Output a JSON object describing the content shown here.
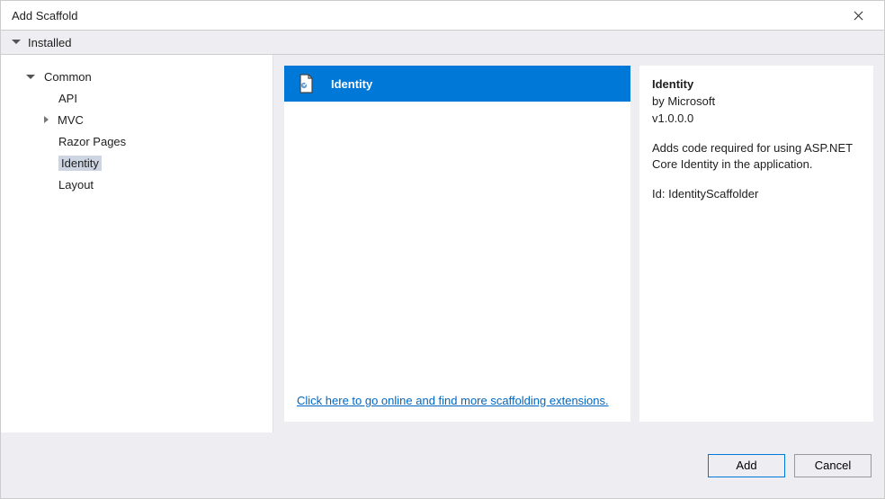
{
  "window": {
    "title": "Add Scaffold"
  },
  "filter": {
    "label": "Installed"
  },
  "sidebar": {
    "items": [
      {
        "label": "Common",
        "level": 1,
        "caret": "open"
      },
      {
        "label": "API",
        "level": 2,
        "caret": "none"
      },
      {
        "label": "MVC",
        "level": 2,
        "caret": "closed"
      },
      {
        "label": "Razor Pages",
        "level": 2,
        "caret": "none"
      },
      {
        "label": "Identity",
        "level": 2,
        "caret": "none",
        "selected": true
      },
      {
        "label": "Layout",
        "level": 2,
        "caret": "none"
      }
    ]
  },
  "center": {
    "items": [
      {
        "label": "Identity",
        "selected": true
      }
    ],
    "online_link": "Click here to go online and find more scaffolding extensions."
  },
  "details": {
    "title": "Identity",
    "by_prefix": "by ",
    "by": "Microsoft",
    "version": "v1.0.0.0",
    "description": "Adds code required for using ASP.NET Core Identity in the application.",
    "id_prefix": "Id: ",
    "id": "IdentityScaffolder"
  },
  "footer": {
    "add": "Add",
    "cancel": "Cancel"
  }
}
